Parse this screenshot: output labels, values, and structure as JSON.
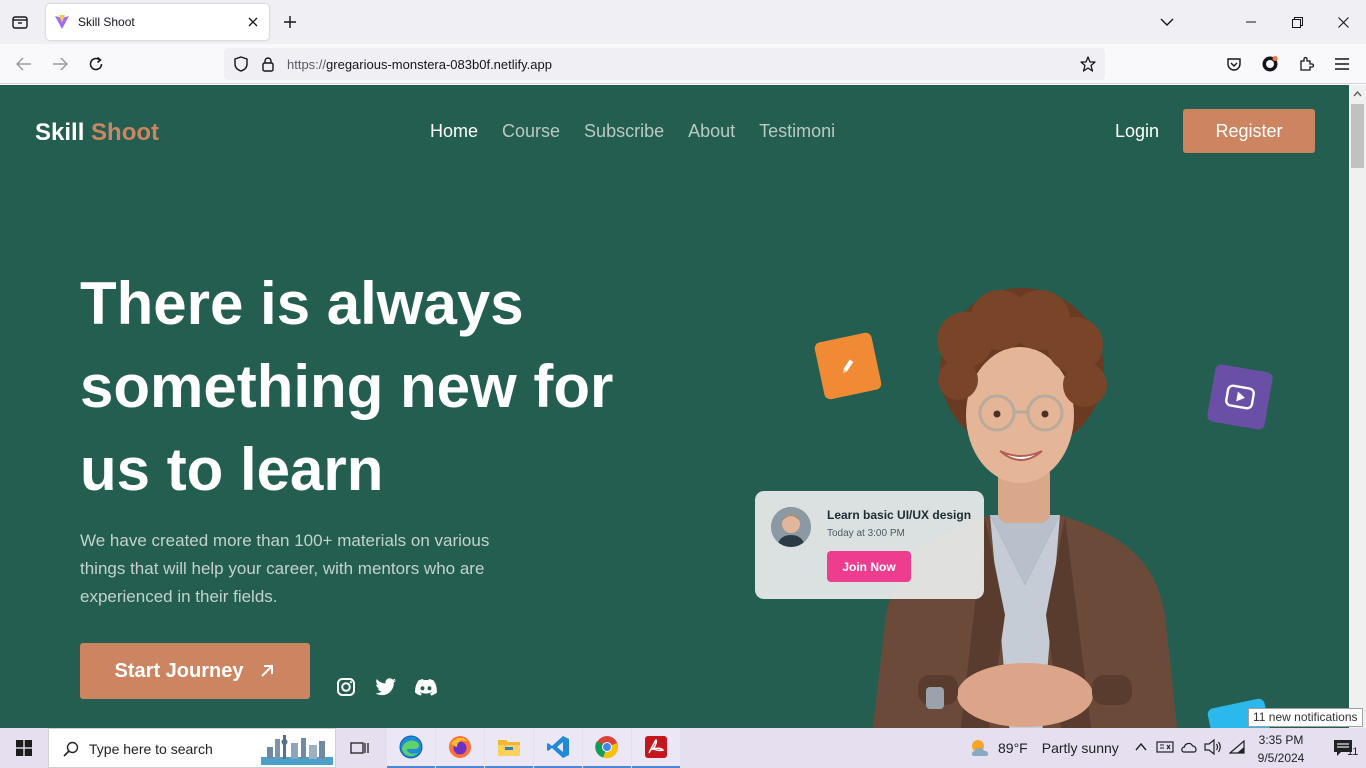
{
  "browser": {
    "tab_title": "Skill Shoot",
    "url_scheme": "https://",
    "url_host": "gregarious-monstera-083b0f.netlify.app"
  },
  "site": {
    "brand_first": "Skill",
    "brand_second": "Shoot",
    "nav": [
      "Home",
      "Course",
      "Subscribe",
      "About",
      "Testimoni"
    ],
    "login_label": "Login",
    "register_label": "Register",
    "hero_title": "There is always something new for us to learn",
    "hero_description": "We have created more than 100+ materials on various things that will help your career, with mentors who are experienced in their fields.",
    "start_label": "Start Journey",
    "social_icons": [
      "instagram-icon",
      "twitter-icon",
      "discord-icon"
    ],
    "card": {
      "title": "Learn basic UI/UX design",
      "time": "Today at 3:00 PM",
      "button": "Join Now"
    },
    "colors": {
      "background": "#245e51",
      "accent": "#cc8560",
      "pink": "#ee3d8f",
      "orange_tile": "#f08a35",
      "purple_tile": "#6a4fa6",
      "blue_tile": "#2bb8ea"
    }
  },
  "taskbar": {
    "search_placeholder": "Type here to search",
    "weather_temp": "89°F",
    "weather_desc": "Partly sunny",
    "time": "3:35 PM",
    "date": "9/5/2024",
    "notification_tooltip": "11 new notifications",
    "notification_count": "11"
  }
}
